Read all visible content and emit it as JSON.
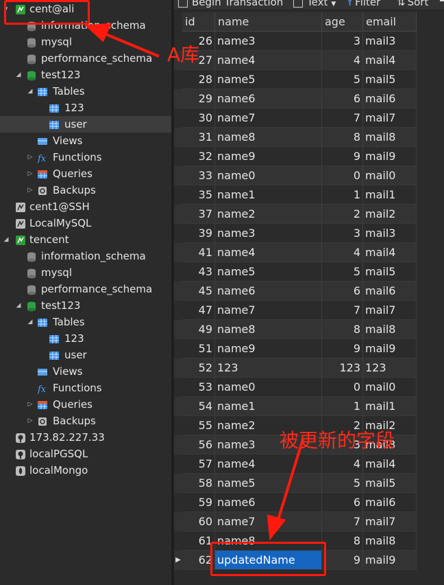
{
  "sidebar": {
    "items": [
      {
        "label": "cent@ali",
        "depth": 0,
        "expander": "▾",
        "icon": "mysql-connection-icon",
        "selected": false
      },
      {
        "label": "information_schema",
        "depth": 1,
        "expander": "",
        "icon": "database-icon",
        "selected": false
      },
      {
        "label": "mysql",
        "depth": 1,
        "expander": "",
        "icon": "database-icon",
        "selected": false
      },
      {
        "label": "performance_schema",
        "depth": 1,
        "expander": "",
        "icon": "database-icon",
        "selected": false
      },
      {
        "label": "test123",
        "depth": 1,
        "expander": "◢",
        "icon": "database-open-icon",
        "selected": false
      },
      {
        "label": "Tables",
        "depth": 2,
        "expander": "◢",
        "icon": "tables-icon",
        "selected": false
      },
      {
        "label": "123",
        "depth": 3,
        "expander": "",
        "icon": "table-icon",
        "selected": false
      },
      {
        "label": "user",
        "depth": 3,
        "expander": "",
        "icon": "table-icon",
        "selected": true
      },
      {
        "label": "Views",
        "depth": 2,
        "expander": "",
        "icon": "views-icon",
        "selected": false
      },
      {
        "label": "Functions",
        "depth": 2,
        "expander": "▷",
        "icon": "functions-icon",
        "selected": false
      },
      {
        "label": "Queries",
        "depth": 2,
        "expander": "▷",
        "icon": "queries-icon",
        "selected": false
      },
      {
        "label": "Backups",
        "depth": 2,
        "expander": "▷",
        "icon": "backups-icon",
        "selected": false
      },
      {
        "label": "cent1@SSH",
        "depth": 0,
        "expander": "",
        "icon": "mysql-connection-gray-icon",
        "selected": false
      },
      {
        "label": "LocalMySQL",
        "depth": 0,
        "expander": "",
        "icon": "mysql-connection-gray-icon",
        "selected": false
      },
      {
        "label": "tencent",
        "depth": 0,
        "expander": "◢",
        "icon": "mysql-connection-icon",
        "selected": false
      },
      {
        "label": "information_schema",
        "depth": 1,
        "expander": "",
        "icon": "database-icon",
        "selected": false
      },
      {
        "label": "mysql",
        "depth": 1,
        "expander": "",
        "icon": "database-icon",
        "selected": false
      },
      {
        "label": "performance_schema",
        "depth": 1,
        "expander": "",
        "icon": "database-icon",
        "selected": false
      },
      {
        "label": "test123",
        "depth": 1,
        "expander": "◢",
        "icon": "database-open-icon",
        "selected": false
      },
      {
        "label": "Tables",
        "depth": 2,
        "expander": "◢",
        "icon": "tables-icon",
        "selected": false
      },
      {
        "label": "123",
        "depth": 3,
        "expander": "",
        "icon": "table-icon",
        "selected": false
      },
      {
        "label": "user",
        "depth": 3,
        "expander": "",
        "icon": "table-icon",
        "selected": false
      },
      {
        "label": "Views",
        "depth": 2,
        "expander": "",
        "icon": "views-icon",
        "selected": false
      },
      {
        "label": "Functions",
        "depth": 2,
        "expander": "",
        "icon": "functions-icon",
        "selected": false
      },
      {
        "label": "Queries",
        "depth": 2,
        "expander": "▷",
        "icon": "queries-icon",
        "selected": false
      },
      {
        "label": "Backups",
        "depth": 2,
        "expander": "▷",
        "icon": "backups-icon",
        "selected": false
      },
      {
        "label": "173.82.227.33",
        "depth": 0,
        "expander": "",
        "icon": "postgres-connection-icon",
        "selected": false
      },
      {
        "label": "localPGSQL",
        "depth": 0,
        "expander": "",
        "icon": "postgres-connection-icon",
        "selected": false
      },
      {
        "label": "localMongo",
        "depth": 0,
        "expander": "",
        "icon": "mongo-connection-icon",
        "selected": false
      }
    ]
  },
  "toolbar": {
    "begin_transaction": "Begin Transaction",
    "text": "Text",
    "filter": "Filter",
    "sort": "Sort"
  },
  "grid": {
    "columns": [
      "id",
      "name",
      "age",
      "email"
    ],
    "rows": [
      {
        "id": "26",
        "name": "name3",
        "age": "3",
        "email": "mail3"
      },
      {
        "id": "27",
        "name": "name4",
        "age": "4",
        "email": "mail4"
      },
      {
        "id": "28",
        "name": "name5",
        "age": "5",
        "email": "mail5"
      },
      {
        "id": "29",
        "name": "name6",
        "age": "6",
        "email": "mail6"
      },
      {
        "id": "30",
        "name": "name7",
        "age": "7",
        "email": "mail7"
      },
      {
        "id": "31",
        "name": "name8",
        "age": "8",
        "email": "mail8"
      },
      {
        "id": "32",
        "name": "name9",
        "age": "9",
        "email": "mail9"
      },
      {
        "id": "33",
        "name": "name0",
        "age": "0",
        "email": "mail0"
      },
      {
        "id": "35",
        "name": "name1",
        "age": "1",
        "email": "mail1"
      },
      {
        "id": "37",
        "name": "name2",
        "age": "2",
        "email": "mail2"
      },
      {
        "id": "39",
        "name": "name3",
        "age": "3",
        "email": "mail3"
      },
      {
        "id": "41",
        "name": "name4",
        "age": "4",
        "email": "mail4"
      },
      {
        "id": "43",
        "name": "name5",
        "age": "5",
        "email": "mail5"
      },
      {
        "id": "45",
        "name": "name6",
        "age": "6",
        "email": "mail6"
      },
      {
        "id": "47",
        "name": "name7",
        "age": "7",
        "email": "mail7"
      },
      {
        "id": "49",
        "name": "name8",
        "age": "8",
        "email": "mail8"
      },
      {
        "id": "51",
        "name": "name9",
        "age": "9",
        "email": "mail9"
      },
      {
        "id": "52",
        "name": "123",
        "age": "123",
        "email": "123"
      },
      {
        "id": "53",
        "name": "name0",
        "age": "0",
        "email": "mail0"
      },
      {
        "id": "54",
        "name": "name1",
        "age": "1",
        "email": "mail1"
      },
      {
        "id": "55",
        "name": "name2",
        "age": "2",
        "email": "mail2"
      },
      {
        "id": "56",
        "name": "name3",
        "age": "3",
        "email": "mail3"
      },
      {
        "id": "57",
        "name": "name4",
        "age": "4",
        "email": "mail4"
      },
      {
        "id": "58",
        "name": "name5",
        "age": "5",
        "email": "mail5"
      },
      {
        "id": "59",
        "name": "name6",
        "age": "6",
        "email": "mail6"
      },
      {
        "id": "60",
        "name": "name7",
        "age": "7",
        "email": "mail7"
      },
      {
        "id": "61",
        "name": "name8",
        "age": "8",
        "email": "mail8"
      },
      {
        "id": "62",
        "name": "updatedName",
        "age": "9",
        "email": "mail9"
      }
    ],
    "current_row_marker": "▶"
  },
  "annotations": {
    "label_a": "A库",
    "label_updated": "被更新的字段",
    "color": "#ff1a0d"
  },
  "colors": {
    "background": "#2b2b2b",
    "selection": "#1565c0",
    "mysql_icon": "#2e9e3a"
  }
}
